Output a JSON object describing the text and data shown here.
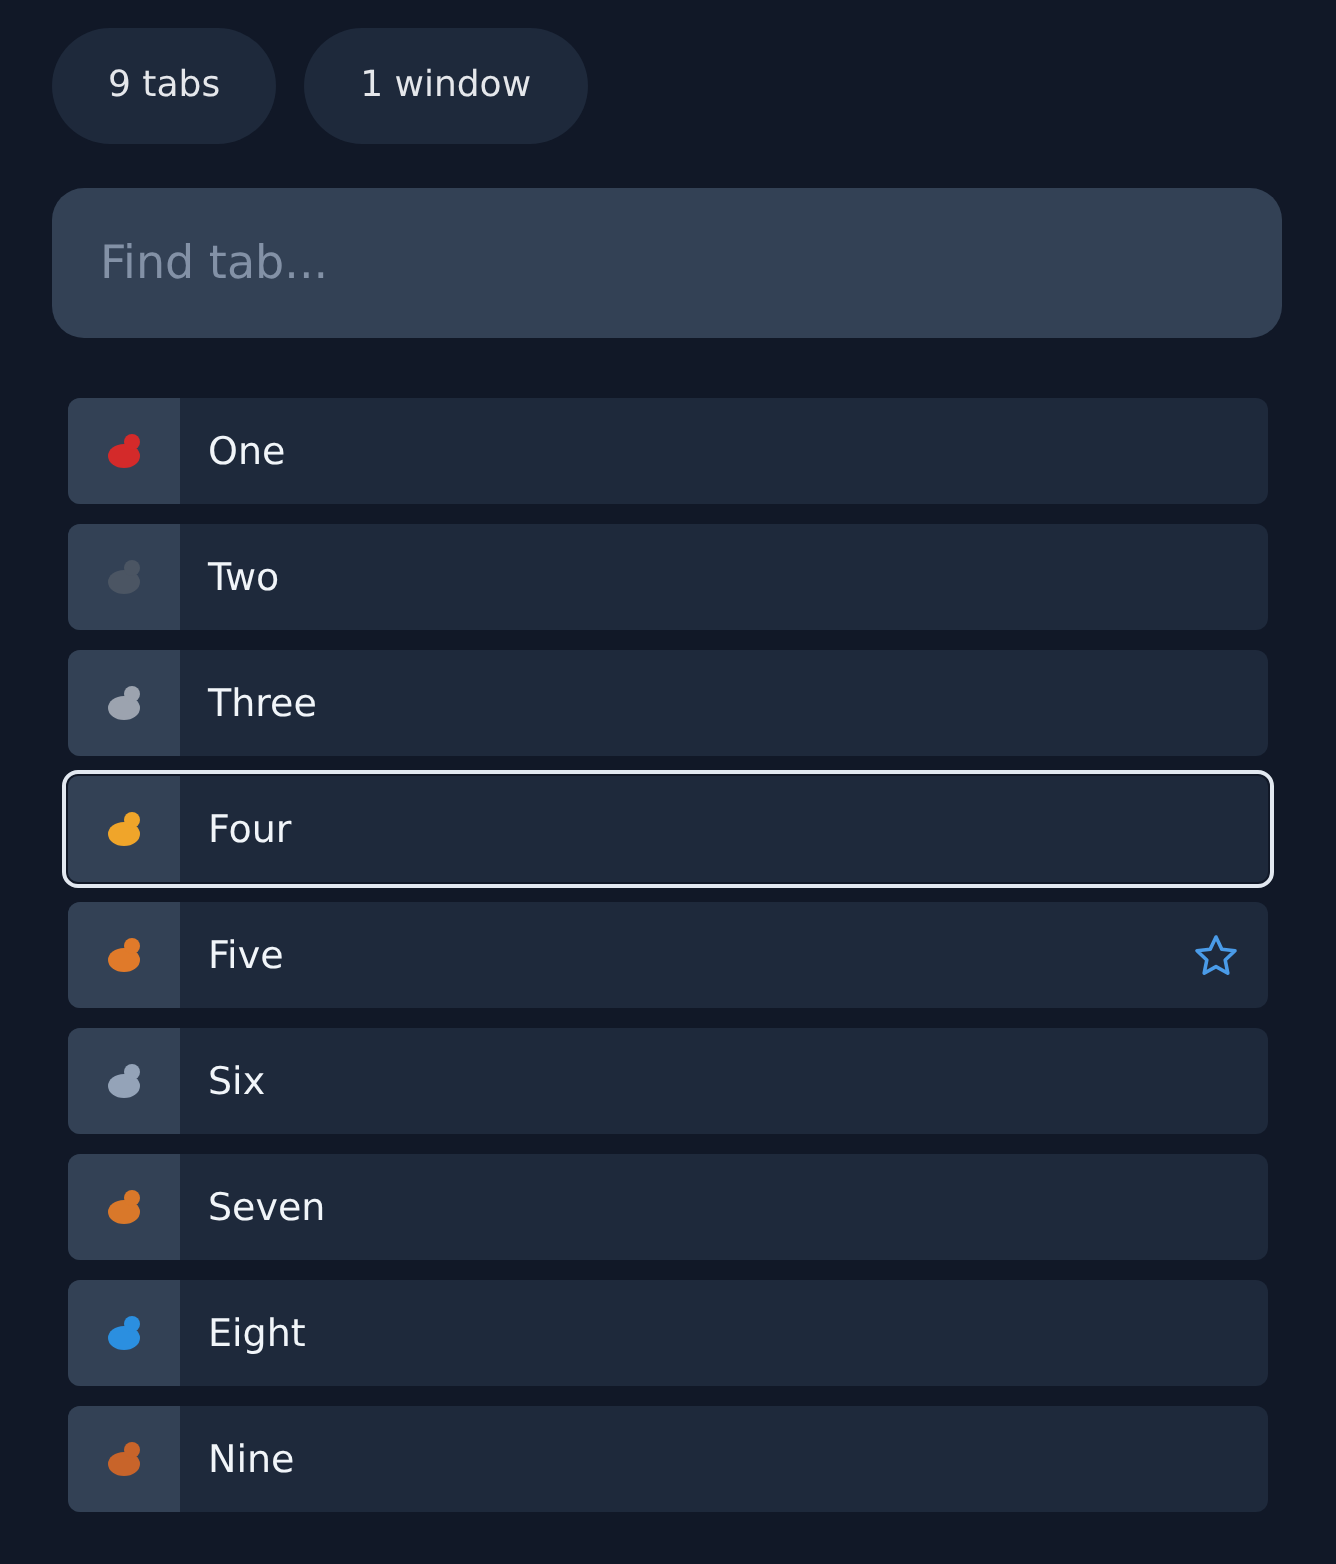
{
  "counts": [
    {
      "label": "9 tabs"
    },
    {
      "label": "1 window"
    }
  ],
  "search": {
    "placeholder": "Find tab..."
  },
  "tabs": [
    {
      "title": "One",
      "selected": false,
      "starred": false
    },
    {
      "title": "Two",
      "selected": false,
      "starred": false
    },
    {
      "title": "Three",
      "selected": false,
      "starred": false
    },
    {
      "title": "Four",
      "selected": true,
      "starred": false
    },
    {
      "title": "Five",
      "selected": false,
      "starred": true
    },
    {
      "title": "Six",
      "selected": false,
      "starred": false
    },
    {
      "title": "Seven",
      "selected": false,
      "starred": false
    },
    {
      "title": "Eight",
      "selected": false,
      "starred": false
    },
    {
      "title": "Nine",
      "selected": false,
      "starred": false
    }
  ]
}
